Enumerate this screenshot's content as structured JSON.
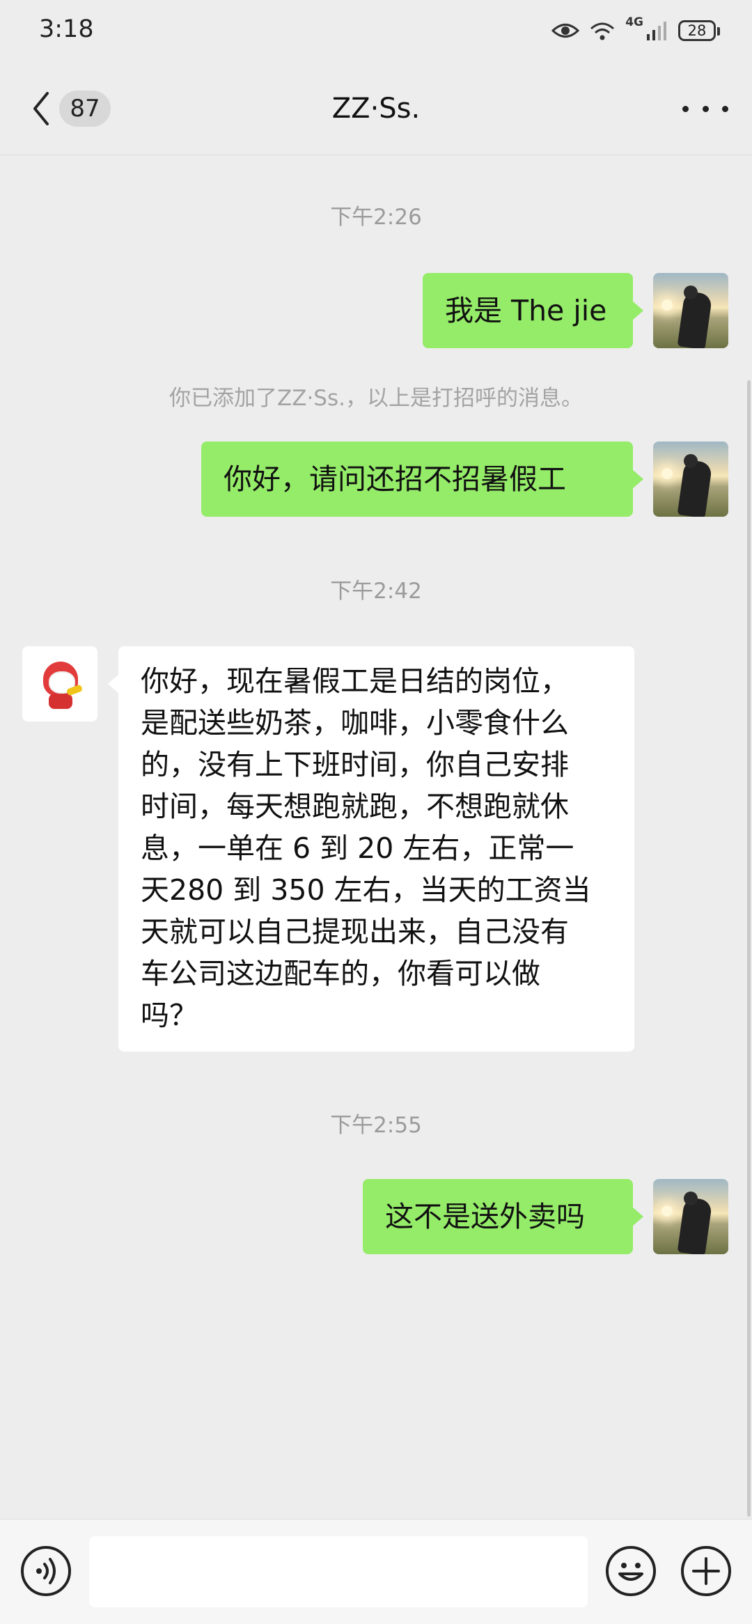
{
  "status_bar": {
    "time": "3:18",
    "network": "4G",
    "battery": "28",
    "icons": [
      "eye-icon",
      "wifi-icon",
      "signal-icon",
      "battery-icon"
    ]
  },
  "nav": {
    "back_icon": "chevron-left-icon",
    "unread_count": "87",
    "title": "ZZ·Ss.",
    "more_icon": "more-dots-icon"
  },
  "messages": [
    {
      "type": "timestamp",
      "text": "下午2:26"
    },
    {
      "type": "message",
      "from": "me",
      "text": "我是 The jie"
    },
    {
      "type": "system",
      "text": "你已添加了ZZ·Ss.，以上是打招呼的消息。"
    },
    {
      "type": "message",
      "from": "me",
      "text": "你好，请问还招不招暑假工"
    },
    {
      "type": "timestamp",
      "text": "下午2:42"
    },
    {
      "type": "message",
      "from": "other",
      "lines": [
        "你好，现在暑假工是日结的岗位，",
        "是配送些奶茶，咖啡，小零食什么",
        "的，没有上下班时间，你自己安排",
        "时间，每天想跑就跑，不想跑就休",
        "息，一单在 6 到 20 左右，正常一",
        "天280 到 350 左右，当天的工资当",
        "天就可以自己提现出来，自己没有",
        "车公司这边配车的，你看可以做",
        "吗？"
      ]
    },
    {
      "type": "timestamp",
      "text": "下午2:55"
    },
    {
      "type": "message",
      "from": "me",
      "text": "这不是送外卖吗"
    }
  ],
  "input_bar": {
    "voice_icon": "voice-icon",
    "input_value": "",
    "emoji_icon": "emoji-icon",
    "plus_icon": "plus-icon"
  },
  "colors": {
    "background": "#ededed",
    "my_bubble": "#95ec69",
    "other_bubble": "#ffffff",
    "timestamp_text": "#9b9b9b"
  }
}
